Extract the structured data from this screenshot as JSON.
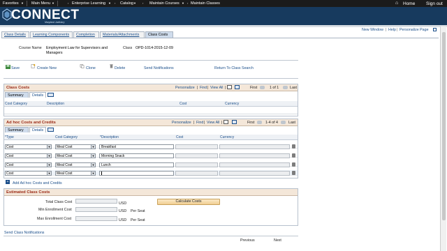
{
  "topnav": {
    "favorites": "Favorites",
    "main_menu": "Main Menu",
    "breadcrumb": [
      "Enterprise Learning",
      "Catalog",
      "Maintain Courses",
      "Maintain Classes"
    ],
    "home": "Home",
    "sign_out": "Sign out"
  },
  "brand": {
    "name": "CONNECT",
    "tagline": "Maryland Judiciary"
  },
  "page_links": {
    "new_window": "New Window",
    "help": "Help",
    "personalize_page": "Personalize Page"
  },
  "tabs": [
    "Class Details",
    "Learning Components",
    "Completion",
    "Materials/Attachments",
    "Class Costs"
  ],
  "course": {
    "course_name_label": "Course Name",
    "course_name_value": "Employment Law for Supervisors and Managers",
    "class_label": "Class",
    "class_value": "OPD-1014-2015-12-09"
  },
  "toolbar": {
    "save": "Save",
    "create_new": "Create New",
    "clone": "Clone",
    "delete": "Delete",
    "send_notifications": "Send Notifications",
    "return_to_search": "Return To Class Search"
  },
  "class_costs": {
    "title": "Class Costs",
    "personalize": "Personalize",
    "find": "Find",
    "view_all": "View All",
    "first": "First",
    "range": "1 of 1",
    "last": "Last",
    "subtabs": [
      "Summary",
      "Details"
    ],
    "columns": [
      "Cost Category",
      "Description",
      "Cost",
      "Currency"
    ]
  },
  "adhoc": {
    "title": "Ad hoc Costs and Credits",
    "personalize": "Personalize",
    "find": "Find",
    "view_all": "View All",
    "first": "First",
    "range": "1-4 of 4",
    "last": "Last",
    "subtabs": [
      "Summary",
      "Details"
    ],
    "columns": [
      "*Type",
      "Cost Category",
      "*Description",
      "Cost",
      "Currency"
    ],
    "rows": [
      {
        "type": "Cost",
        "category": "Meal Cost",
        "description": "Breakfast"
      },
      {
        "type": "Cost",
        "category": "Meal Cost",
        "description": "Morning Snack"
      },
      {
        "type": "Cost",
        "category": "Meal Cost",
        "description": "Lunch"
      },
      {
        "type": "Cost",
        "category": "Meal Cost",
        "description": ""
      }
    ],
    "add_link": "Add Ad hoc Costs and Credits"
  },
  "estimated": {
    "title": "Estimated Class Costs",
    "total_label": "Total Class Cost",
    "min_label": "Min Enrollment Cost",
    "max_label": "Max Enrollment Cost",
    "currency": "USD",
    "per_seat": "Per Seat",
    "calculate_button": "Calculate Costs"
  },
  "footer": {
    "send_class_notifications": "Send Class Notifications",
    "previous": "Previous",
    "next": "Next"
  },
  "colors": {
    "nav_bg": "#1b1b1b",
    "banner_bg": "#173a5e",
    "section_title": "#9b2a16",
    "link": "#1a4e8a"
  }
}
